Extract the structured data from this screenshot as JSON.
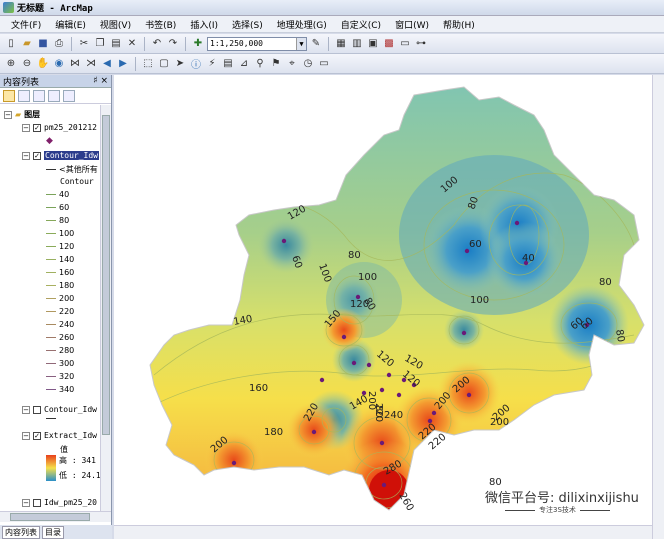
{
  "window": {
    "title": "无标题 - ArcMap"
  },
  "menu": [
    "文件(F)",
    "编辑(E)",
    "视图(V)",
    "书签(B)",
    "插入(I)",
    "选择(S)",
    "地理处理(G)",
    "自定义(C)",
    "窗口(W)",
    "帮助(H)"
  ],
  "toolbar": {
    "scale": "1:1,250,000"
  },
  "toc": {
    "title": "内容列表",
    "pin": "♯ ×",
    "layers_root": "图层",
    "pm25_layer": "pm25_201212",
    "contour_layer": "Contour_Idw",
    "other_values": "<其他所有",
    "contour_field": "Contour",
    "contour_values": [
      "40",
      "60",
      "80",
      "100",
      "120",
      "140",
      "160",
      "180",
      "200",
      "220",
      "240",
      "260",
      "280",
      "300",
      "320",
      "340"
    ],
    "contour_layer2": "Contour_Idw",
    "extract_layer": "Extract_Idw",
    "value_label": "值",
    "high_label": "高 : 341",
    "low_label": "低 : 24.1",
    "idw_layer": "Idw_pm25_20",
    "tabs": [
      "内容列表",
      "目录"
    ]
  },
  "map": {
    "contour_labels": [
      {
        "t": "120"
      },
      {
        "t": "100"
      },
      {
        "t": "80"
      },
      {
        "t": "100"
      },
      {
        "t": "80"
      },
      {
        "t": "60"
      },
      {
        "t": "40"
      },
      {
        "t": "60"
      },
      {
        "t": "80"
      },
      {
        "t": "80"
      },
      {
        "t": "100"
      },
      {
        "t": "60"
      },
      {
        "t": "80"
      },
      {
        "t": "100"
      },
      {
        "t": "120"
      },
      {
        "t": "140"
      },
      {
        "t": "150"
      },
      {
        "t": "120"
      },
      {
        "t": "120"
      },
      {
        "t": "160"
      },
      {
        "t": "140"
      },
      {
        "t": "180"
      },
      {
        "t": "200"
      },
      {
        "t": "220"
      },
      {
        "t": "200"
      },
      {
        "t": "220"
      },
      {
        "t": "240"
      },
      {
        "t": "200"
      },
      {
        "t": "200"
      },
      {
        "t": "220"
      },
      {
        "t": "280"
      },
      {
        "t": "260"
      },
      {
        "t": "120"
      },
      {
        "t": "80"
      },
      {
        "t": "60"
      },
      {
        "t": "80"
      },
      {
        "t": "200"
      },
      {
        "t": "220"
      },
      {
        "t": "200"
      }
    ]
  },
  "watermark": {
    "main": "微信平台号: dilixinxijishu",
    "sub": "专注3S技术"
  },
  "colors": {
    "high": "#e8401c",
    "mid": "#f5e04a",
    "low": "#2a8fc8"
  }
}
